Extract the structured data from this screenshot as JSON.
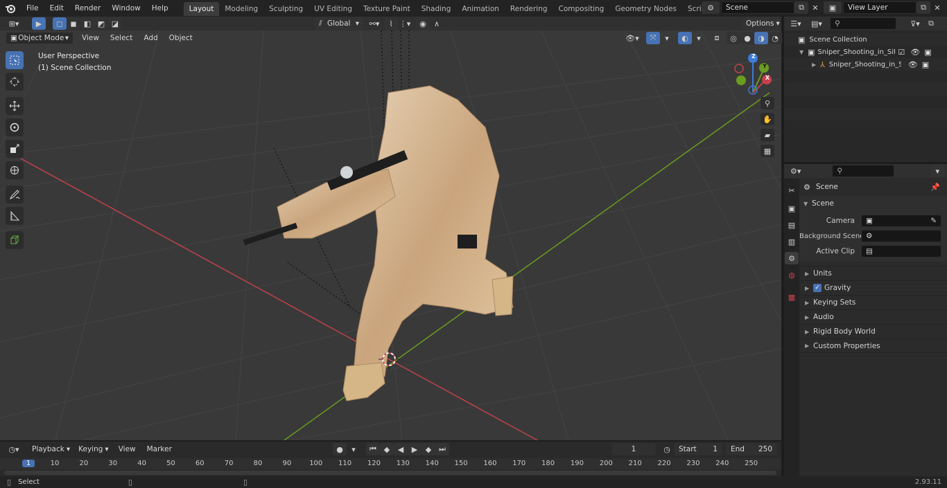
{
  "topbar": {
    "menus": [
      "File",
      "Edit",
      "Render",
      "Window",
      "Help"
    ],
    "workspaces": [
      "Layout",
      "Modeling",
      "Sculpting",
      "UV Editing",
      "Texture Paint",
      "Shading",
      "Animation",
      "Rendering",
      "Compositing",
      "Geometry Nodes",
      "Scripting"
    ],
    "add_tab": "+",
    "scene_name": "Scene",
    "view_layer_name": "View Layer"
  },
  "viewport_header": {
    "mode": "Object Mode",
    "menus": [
      "View",
      "Select",
      "Add",
      "Object"
    ],
    "transform_orientation": "Global",
    "options_label": "Options"
  },
  "viewport": {
    "perspective_label": "User Perspective",
    "collection_label": "(1) Scene Collection",
    "gizmo_axes": {
      "x": "X",
      "y": "Y",
      "z": "Z"
    }
  },
  "outliner": {
    "root": "Scene Collection",
    "items": [
      {
        "label": "Sniper_Shooting_in_Sitting_Pc",
        "level": 1
      },
      {
        "label": "Sniper_Shooting_in_Sittin",
        "level": 2
      }
    ]
  },
  "properties": {
    "context_title": "Scene",
    "section_title": "Scene",
    "fields": [
      {
        "label": "Camera"
      },
      {
        "label": "Background Scene"
      },
      {
        "label": "Active Clip"
      }
    ],
    "panels": [
      "Units",
      "Gravity",
      "Keying Sets",
      "Audio",
      "Rigid Body World",
      "Custom Properties"
    ],
    "gravity_checked": true
  },
  "timeline": {
    "menus": [
      "Playback",
      "Keying",
      "View",
      "Marker"
    ],
    "current_frame": "1",
    "start_label": "Start",
    "start_value": "1",
    "end_label": "End",
    "end_value": "250",
    "ruler": [
      "1",
      "10",
      "20",
      "30",
      "40",
      "50",
      "60",
      "70",
      "80",
      "90",
      "100",
      "110",
      "120",
      "130",
      "140",
      "150",
      "160",
      "170",
      "180",
      "190",
      "200",
      "210",
      "220",
      "230",
      "240",
      "250"
    ]
  },
  "statusbar": {
    "left_label": "Select",
    "version": "2.93.11"
  },
  "colors": {
    "accent": "#4772b3",
    "x_axis": "#c2424c",
    "y_axis": "#6a9c1f",
    "z_axis": "#3d7bd6",
    "viewport_bg": "#393939"
  }
}
